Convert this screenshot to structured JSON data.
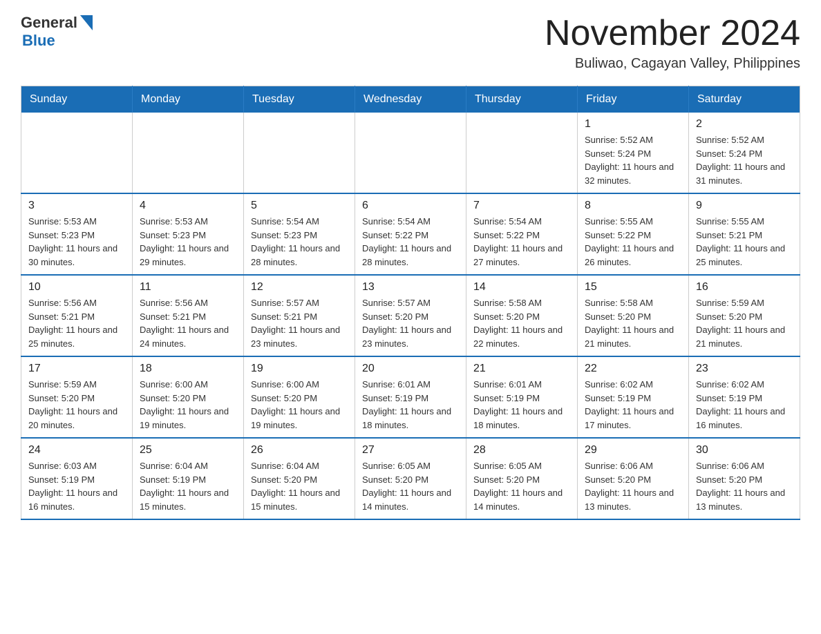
{
  "logo": {
    "text_general": "General",
    "text_blue": "Blue",
    "triangle": "▶"
  },
  "title": "November 2024",
  "location": "Buliwao, Cagayan Valley, Philippines",
  "days_of_week": [
    "Sunday",
    "Monday",
    "Tuesday",
    "Wednesday",
    "Thursday",
    "Friday",
    "Saturday"
  ],
  "weeks": [
    [
      {
        "day": "",
        "info": ""
      },
      {
        "day": "",
        "info": ""
      },
      {
        "day": "",
        "info": ""
      },
      {
        "day": "",
        "info": ""
      },
      {
        "day": "",
        "info": ""
      },
      {
        "day": "1",
        "info": "Sunrise: 5:52 AM\nSunset: 5:24 PM\nDaylight: 11 hours and 32 minutes."
      },
      {
        "day": "2",
        "info": "Sunrise: 5:52 AM\nSunset: 5:24 PM\nDaylight: 11 hours and 31 minutes."
      }
    ],
    [
      {
        "day": "3",
        "info": "Sunrise: 5:53 AM\nSunset: 5:23 PM\nDaylight: 11 hours and 30 minutes."
      },
      {
        "day": "4",
        "info": "Sunrise: 5:53 AM\nSunset: 5:23 PM\nDaylight: 11 hours and 29 minutes."
      },
      {
        "day": "5",
        "info": "Sunrise: 5:54 AM\nSunset: 5:23 PM\nDaylight: 11 hours and 28 minutes."
      },
      {
        "day": "6",
        "info": "Sunrise: 5:54 AM\nSunset: 5:22 PM\nDaylight: 11 hours and 28 minutes."
      },
      {
        "day": "7",
        "info": "Sunrise: 5:54 AM\nSunset: 5:22 PM\nDaylight: 11 hours and 27 minutes."
      },
      {
        "day": "8",
        "info": "Sunrise: 5:55 AM\nSunset: 5:22 PM\nDaylight: 11 hours and 26 minutes."
      },
      {
        "day": "9",
        "info": "Sunrise: 5:55 AM\nSunset: 5:21 PM\nDaylight: 11 hours and 25 minutes."
      }
    ],
    [
      {
        "day": "10",
        "info": "Sunrise: 5:56 AM\nSunset: 5:21 PM\nDaylight: 11 hours and 25 minutes."
      },
      {
        "day": "11",
        "info": "Sunrise: 5:56 AM\nSunset: 5:21 PM\nDaylight: 11 hours and 24 minutes."
      },
      {
        "day": "12",
        "info": "Sunrise: 5:57 AM\nSunset: 5:21 PM\nDaylight: 11 hours and 23 minutes."
      },
      {
        "day": "13",
        "info": "Sunrise: 5:57 AM\nSunset: 5:20 PM\nDaylight: 11 hours and 23 minutes."
      },
      {
        "day": "14",
        "info": "Sunrise: 5:58 AM\nSunset: 5:20 PM\nDaylight: 11 hours and 22 minutes."
      },
      {
        "day": "15",
        "info": "Sunrise: 5:58 AM\nSunset: 5:20 PM\nDaylight: 11 hours and 21 minutes."
      },
      {
        "day": "16",
        "info": "Sunrise: 5:59 AM\nSunset: 5:20 PM\nDaylight: 11 hours and 21 minutes."
      }
    ],
    [
      {
        "day": "17",
        "info": "Sunrise: 5:59 AM\nSunset: 5:20 PM\nDaylight: 11 hours and 20 minutes."
      },
      {
        "day": "18",
        "info": "Sunrise: 6:00 AM\nSunset: 5:20 PM\nDaylight: 11 hours and 19 minutes."
      },
      {
        "day": "19",
        "info": "Sunrise: 6:00 AM\nSunset: 5:20 PM\nDaylight: 11 hours and 19 minutes."
      },
      {
        "day": "20",
        "info": "Sunrise: 6:01 AM\nSunset: 5:19 PM\nDaylight: 11 hours and 18 minutes."
      },
      {
        "day": "21",
        "info": "Sunrise: 6:01 AM\nSunset: 5:19 PM\nDaylight: 11 hours and 18 minutes."
      },
      {
        "day": "22",
        "info": "Sunrise: 6:02 AM\nSunset: 5:19 PM\nDaylight: 11 hours and 17 minutes."
      },
      {
        "day": "23",
        "info": "Sunrise: 6:02 AM\nSunset: 5:19 PM\nDaylight: 11 hours and 16 minutes."
      }
    ],
    [
      {
        "day": "24",
        "info": "Sunrise: 6:03 AM\nSunset: 5:19 PM\nDaylight: 11 hours and 16 minutes."
      },
      {
        "day": "25",
        "info": "Sunrise: 6:04 AM\nSunset: 5:19 PM\nDaylight: 11 hours and 15 minutes."
      },
      {
        "day": "26",
        "info": "Sunrise: 6:04 AM\nSunset: 5:20 PM\nDaylight: 11 hours and 15 minutes."
      },
      {
        "day": "27",
        "info": "Sunrise: 6:05 AM\nSunset: 5:20 PM\nDaylight: 11 hours and 14 minutes."
      },
      {
        "day": "28",
        "info": "Sunrise: 6:05 AM\nSunset: 5:20 PM\nDaylight: 11 hours and 14 minutes."
      },
      {
        "day": "29",
        "info": "Sunrise: 6:06 AM\nSunset: 5:20 PM\nDaylight: 11 hours and 13 minutes."
      },
      {
        "day": "30",
        "info": "Sunrise: 6:06 AM\nSunset: 5:20 PM\nDaylight: 11 hours and 13 minutes."
      }
    ]
  ]
}
